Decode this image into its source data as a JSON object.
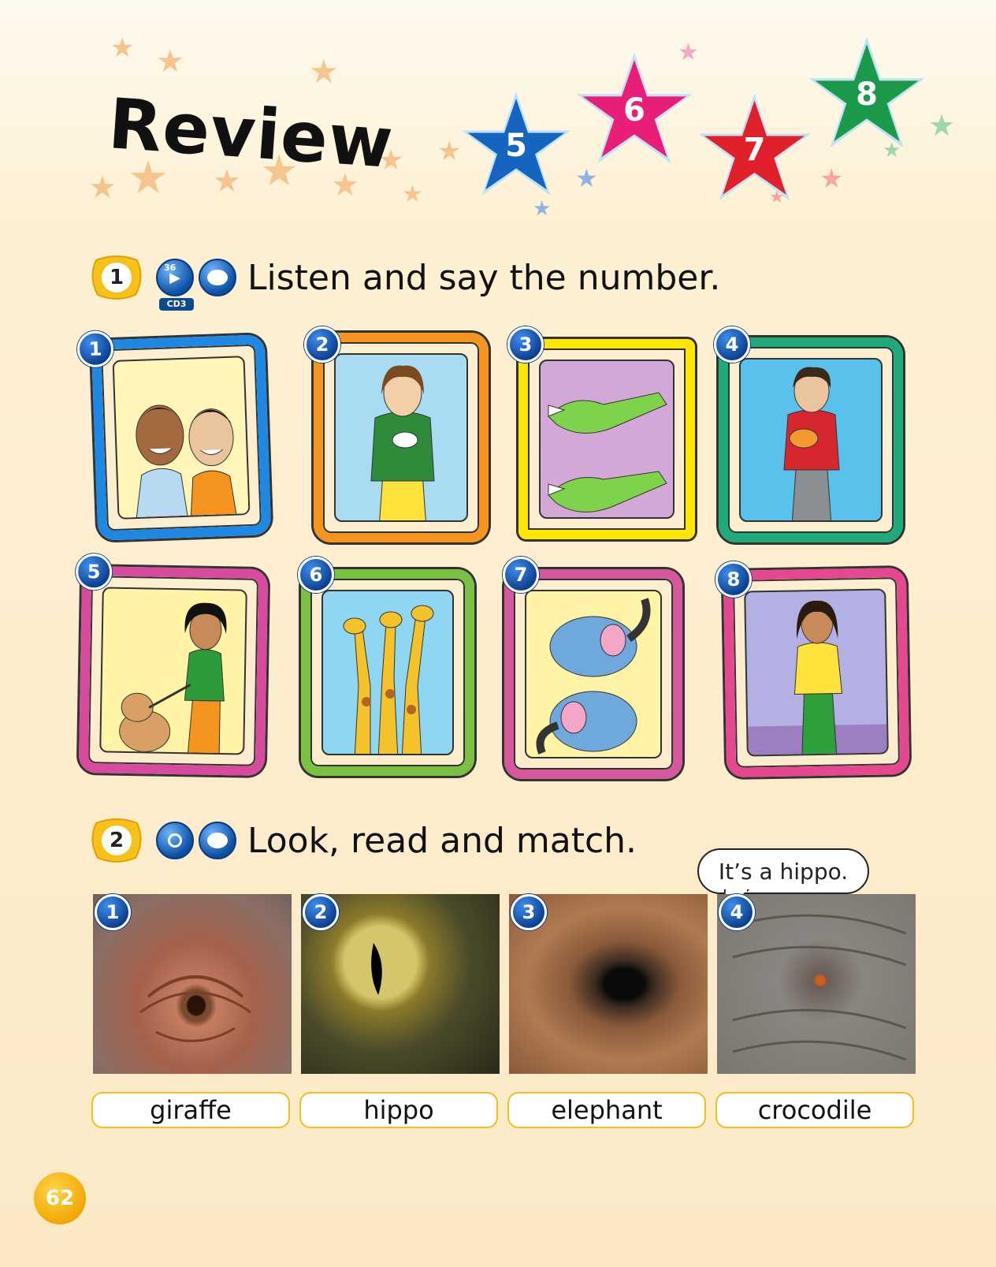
{
  "header": {
    "title": "Review",
    "unit_stars": [
      {
        "label": "5",
        "color": "#1565c0"
      },
      {
        "label": "6",
        "color": "#e91e78"
      },
      {
        "label": "7",
        "color": "#e0202a"
      },
      {
        "label": "8",
        "color": "#1a9a4a"
      }
    ]
  },
  "exercise1": {
    "number": "1",
    "audio_track": "36",
    "cd_label": "CD3",
    "instruction": "Listen and say the number.",
    "pictures": [
      {
        "number": "1",
        "frame_color": "#1e88e5"
      },
      {
        "number": "2",
        "frame_color": "#f5941f"
      },
      {
        "number": "3",
        "frame_color": "#ffe600"
      },
      {
        "number": "4",
        "frame_color": "#1faa7c"
      },
      {
        "number": "5",
        "frame_color": "#d84a9e"
      },
      {
        "number": "6",
        "frame_color": "#7ac143"
      },
      {
        "number": "7",
        "frame_color": "#d6589c"
      },
      {
        "number": "8",
        "frame_color": "#e5488f"
      }
    ]
  },
  "exercise2": {
    "number": "2",
    "instruction": "Look, read and match.",
    "speech_bubble": "It’s a hippo.",
    "photos": [
      {
        "number": "1"
      },
      {
        "number": "2"
      },
      {
        "number": "3"
      },
      {
        "number": "4"
      }
    ],
    "words": [
      "giraffe",
      "hippo",
      "elephant",
      "crocodile"
    ]
  },
  "page_number": "62"
}
